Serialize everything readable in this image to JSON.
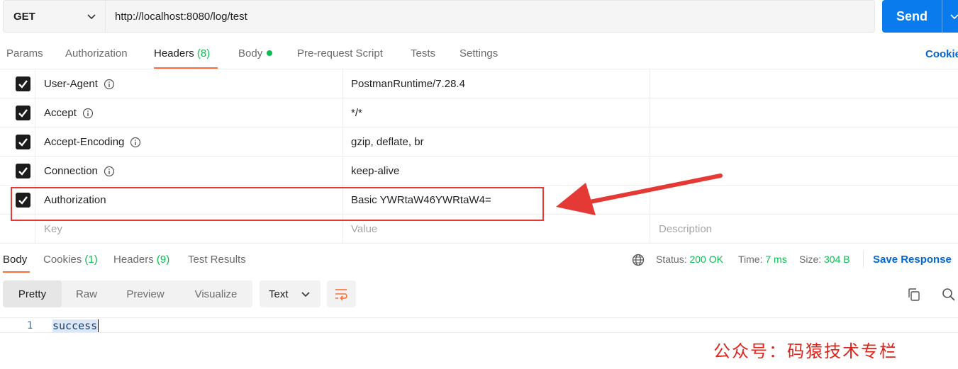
{
  "request": {
    "method": "GET",
    "url": "http://localhost:8080/log/test",
    "send_label": "Send"
  },
  "tabs": [
    {
      "label": "Params"
    },
    {
      "label": "Authorization"
    },
    {
      "label": "Headers",
      "count": "(8)",
      "active": true
    },
    {
      "label": "Body",
      "indicator": "green-dot"
    },
    {
      "label": "Pre-request Script"
    },
    {
      "label": "Tests"
    },
    {
      "label": "Settings"
    }
  ],
  "cookies_link": "Cookie",
  "headers": {
    "rows": [
      {
        "checked": true,
        "key": "User-Agent",
        "info_icon": true,
        "value": "PostmanRuntime/7.28.4"
      },
      {
        "checked": true,
        "key": "Accept",
        "info_icon": true,
        "value": "*/*"
      },
      {
        "checked": true,
        "key": "Accept-Encoding",
        "info_icon": true,
        "value": "gzip, deflate, br"
      },
      {
        "checked": true,
        "key": "Connection",
        "info_icon": true,
        "value": "keep-alive"
      },
      {
        "checked": true,
        "key": "Authorization",
        "info_icon": false,
        "value": "Basic YWRtaW46YWRtaW4=",
        "highlighted": true
      }
    ],
    "placeholders": {
      "key": "Key",
      "value": "Value",
      "description": "Description"
    }
  },
  "response": {
    "tabs": [
      {
        "label": "Body",
        "active": true
      },
      {
        "label": "Cookies",
        "count": "(1)"
      },
      {
        "label": "Headers",
        "count": "(9)"
      },
      {
        "label": "Test Results"
      }
    ],
    "status_label": "Status:",
    "status_value": "200 OK",
    "time_label": "Time:",
    "time_value": "7 ms",
    "size_label": "Size:",
    "size_value": "304 B",
    "save_label": "Save Response",
    "formats": [
      "Pretty",
      "Raw",
      "Preview",
      "Visualize"
    ],
    "active_format": "Pretty",
    "language": "Text",
    "line_number": "1",
    "body": "success"
  },
  "watermark": "公众号：码猿技术专栏",
  "colors": {
    "accent_orange": "#ff6c37",
    "send_blue": "#097bed",
    "link_blue": "#0265d2",
    "status_green": "#0cbb52",
    "annotation_red": "#e53935"
  }
}
